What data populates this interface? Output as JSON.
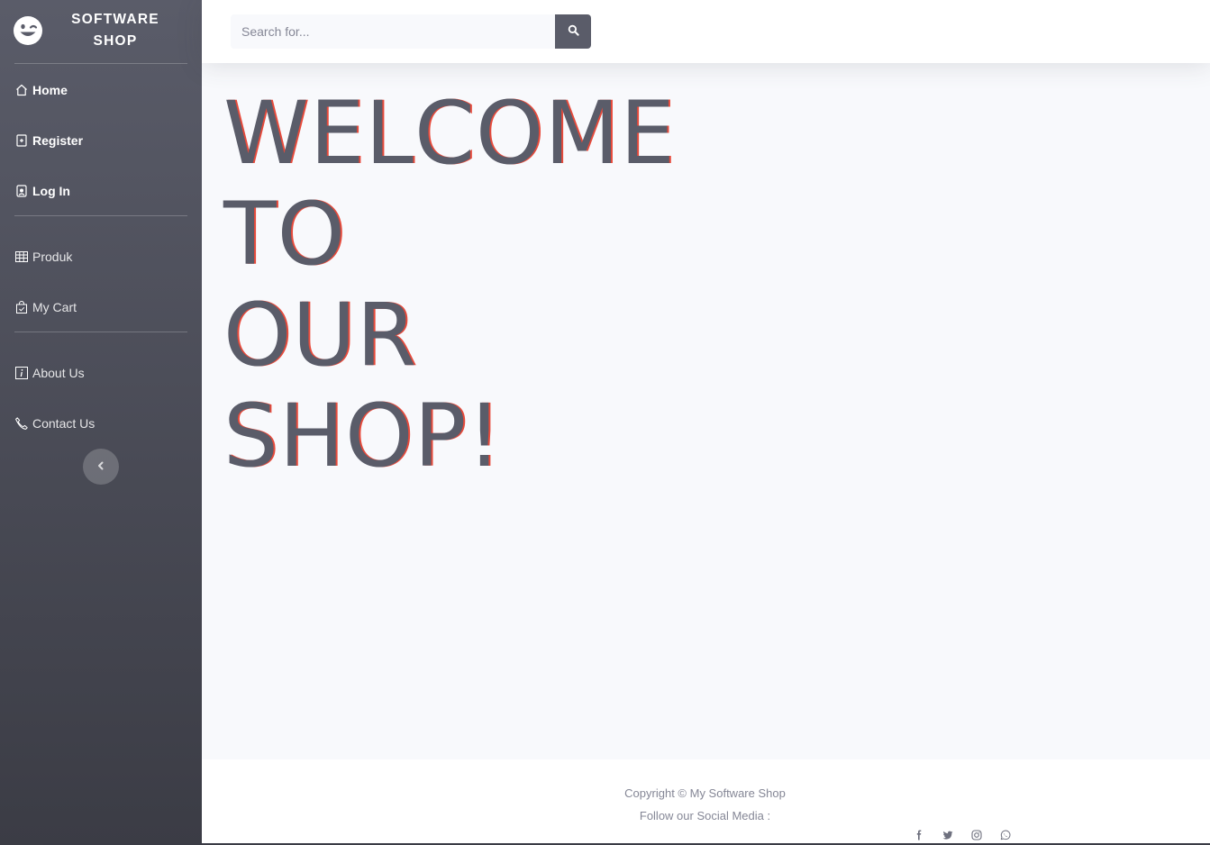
{
  "brand": {
    "name": "SOFTWARE SHOP",
    "icon": "grin-wink-icon"
  },
  "sidebar": {
    "groups": [
      {
        "items": [
          {
            "label": "Home",
            "icon": "house-icon",
            "bold": true
          },
          {
            "label": "Register",
            "icon": "plus-square-icon",
            "bold": true
          },
          {
            "label": "Log In",
            "icon": "person-badge-icon",
            "bold": true
          }
        ]
      },
      {
        "items": [
          {
            "label": "Produk",
            "icon": "table-icon",
            "bold": false
          },
          {
            "label": "My Cart",
            "icon": "bag-check-icon",
            "bold": false
          }
        ]
      },
      {
        "items": [
          {
            "label": "About Us",
            "icon": "info-square-icon",
            "bold": false
          },
          {
            "label": "Contact Us",
            "icon": "telephone-icon",
            "bold": false
          }
        ]
      }
    ],
    "toggle_icon": "chevron-left-icon"
  },
  "search": {
    "placeholder": "Search for...",
    "value": "",
    "button_icon": "search-icon"
  },
  "hero": {
    "lines": [
      "WELCOME",
      "TO",
      "OUR",
      "SHOP!"
    ]
  },
  "footer": {
    "copyright": "Copyright © My Software Shop",
    "follow": "Follow our Social Media :",
    "social_icons": [
      "facebook-icon",
      "twitter-icon",
      "instagram-icon",
      "whatsapp-icon"
    ]
  },
  "colors": {
    "sidebar_top": "#5a5c69",
    "sidebar_bottom": "#3b3c45",
    "hero_text": "#5a5c69",
    "hero_shadow": "#e74a3b",
    "background": "#f8f9fc"
  }
}
